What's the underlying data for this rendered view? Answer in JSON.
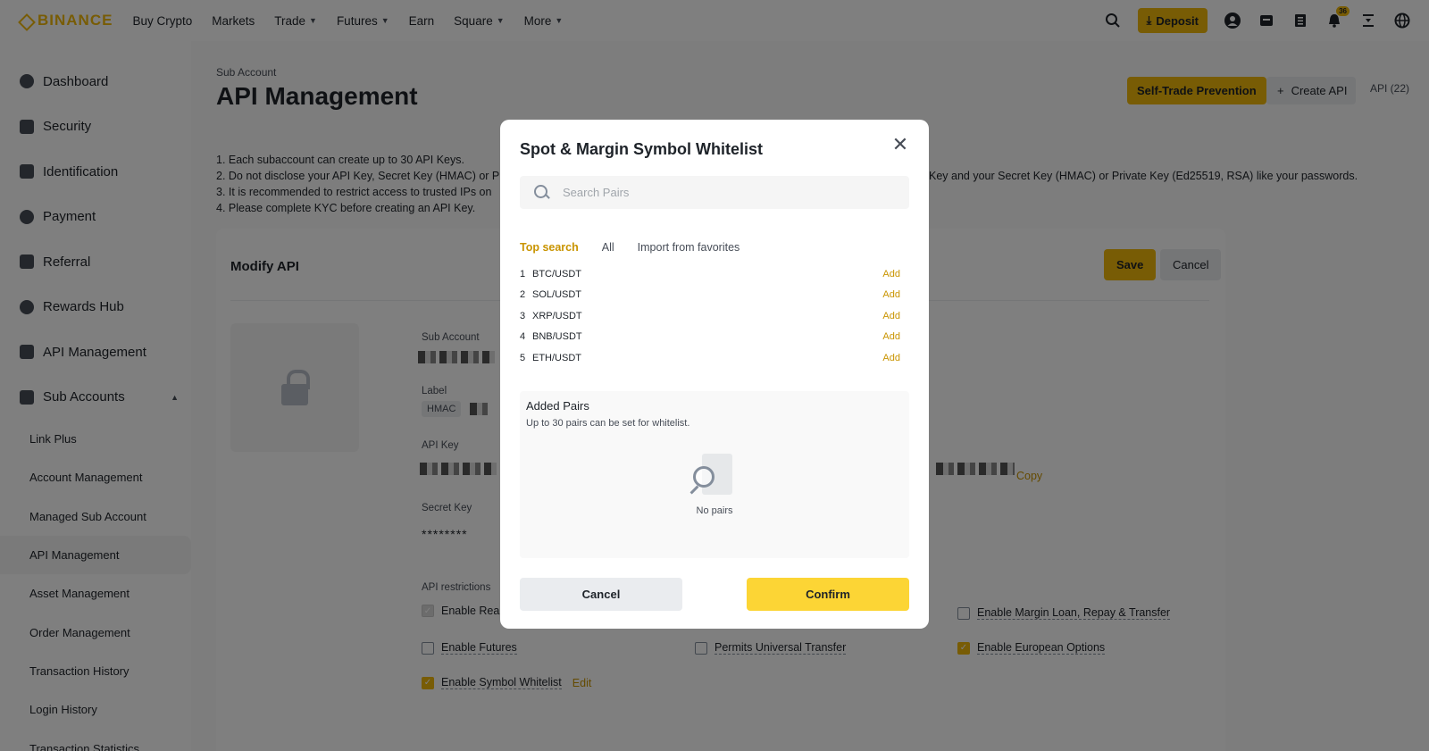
{
  "colors": {
    "accent": "#F0B90B",
    "link": "#C99400",
    "confirm": "#FCD535"
  },
  "brand": "BINANCE",
  "nav": {
    "items": [
      {
        "label": "Buy Crypto",
        "dropdown": false
      },
      {
        "label": "Markets",
        "dropdown": false
      },
      {
        "label": "Trade",
        "dropdown": true
      },
      {
        "label": "Futures",
        "dropdown": true
      },
      {
        "label": "Earn",
        "dropdown": false
      },
      {
        "label": "Square",
        "dropdown": true
      },
      {
        "label": "More",
        "dropdown": true
      }
    ],
    "deposit_label": "Deposit",
    "notification_count": "36"
  },
  "sidebar": {
    "items": [
      {
        "label": "Dashboard",
        "icon": "user-icon"
      },
      {
        "label": "Security",
        "icon": "shield-icon"
      },
      {
        "label": "Identification",
        "icon": "id-card-icon"
      },
      {
        "label": "Payment",
        "icon": "dollar-icon"
      },
      {
        "label": "Referral",
        "icon": "add-user-icon"
      },
      {
        "label": "Rewards Hub",
        "icon": "medal-icon"
      },
      {
        "label": "API Management",
        "icon": "api-icon"
      },
      {
        "label": "Sub Accounts",
        "icon": "users-icon"
      }
    ],
    "sub_items": [
      {
        "label": "Link Plus"
      },
      {
        "label": "Account Management"
      },
      {
        "label": "Managed Sub Account"
      },
      {
        "label": "API Management"
      },
      {
        "label": "Asset Management"
      },
      {
        "label": "Order Management"
      },
      {
        "label": "Transaction History"
      },
      {
        "label": "Login History"
      },
      {
        "label": "Transaction Statistics"
      }
    ]
  },
  "page": {
    "breadcrumb": "Sub Account",
    "title": "API Management",
    "self_trade_label": "Self-Trade Prevention",
    "create_api_label": "Create API",
    "api_count": "API (22)",
    "notes": [
      "1. Each subaccount can create up to 30 API Keys.",
      "2. Do not disclose your API Key, Secret Key (HMAC) or Pr",
      "3. It is recommended to restrict access to trusted IPs on",
      "4. Please complete KYC before creating an API Key."
    ],
    "notes_right": "Key and your Secret Key (HMAC) or Private Key (Ed25519, RSA) like your passwords."
  },
  "card": {
    "title": "Modify API",
    "save_label": "Save",
    "cancel_label": "Cancel",
    "sub_account_label": "Sub Account",
    "label_label": "Label",
    "hmac_tag": "HMAC",
    "api_key_label": "API Key",
    "copy_label": "Copy",
    "secret_key_label": "Secret Key",
    "secret_value": "********",
    "restrictions_label": "API restrictions",
    "checks": {
      "reading": "Enable Rea",
      "margin_loan": "Enable Margin Loan, Repay & Transfer",
      "futures": "Enable Futures",
      "universal": "Permits Universal Transfer",
      "european": "Enable European Options",
      "whitelist": "Enable Symbol Whitelist",
      "edit": "Edit"
    }
  },
  "modal": {
    "title": "Spot & Margin Symbol Whitelist",
    "search_placeholder": "Search Pairs",
    "tabs": [
      {
        "label": "Top search",
        "active": true
      },
      {
        "label": "All",
        "active": false
      },
      {
        "label": "Import from favorites",
        "active": false
      }
    ],
    "pairs": [
      {
        "rank": "1",
        "symbol": "BTC/USDT",
        "action": "Add"
      },
      {
        "rank": "2",
        "symbol": "SOL/USDT",
        "action": "Add"
      },
      {
        "rank": "3",
        "symbol": "XRP/USDT",
        "action": "Add"
      },
      {
        "rank": "4",
        "symbol": "BNB/USDT",
        "action": "Add"
      },
      {
        "rank": "5",
        "symbol": "ETH/USDT",
        "action": "Add"
      }
    ],
    "added_title": "Added Pairs",
    "added_subtitle": "Up to 30 pairs can be set for whitelist.",
    "empty_text": "No pairs",
    "cancel_label": "Cancel",
    "confirm_label": "Confirm"
  }
}
